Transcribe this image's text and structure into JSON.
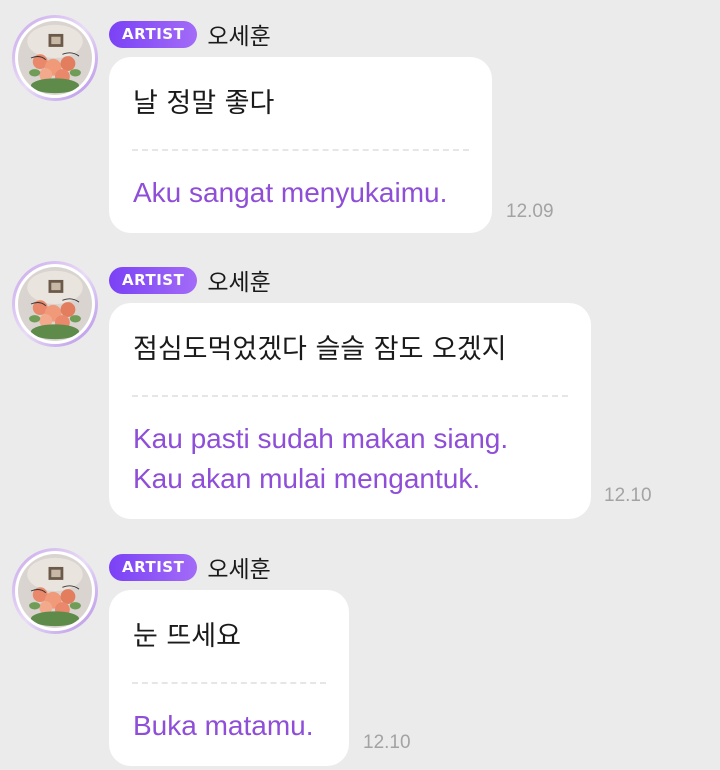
{
  "colors": {
    "background": "#ebebeb",
    "bubble": "#ffffff",
    "badge_start": "#7a42f5",
    "badge_end": "#a36bf7",
    "translation_text": "#8e4ed8",
    "timestamp": "#a3a3a3"
  },
  "messages": [
    {
      "avatar_icon": "profile-avatar-flowers",
      "badge": "ARTIST",
      "sender": "오세훈",
      "original": "날 정말 좋다",
      "translation_lines": [
        "Aku sangat menyukaimu."
      ],
      "time": "12.09"
    },
    {
      "avatar_icon": "profile-avatar-flowers",
      "badge": "ARTIST",
      "sender": "오세훈",
      "original": "점심도먹었겠다 슬슬 잠도 오겠지",
      "translation_lines": [
        "Kau pasti sudah makan siang.",
        "Kau akan mulai mengantuk."
      ],
      "time": "12.10"
    },
    {
      "avatar_icon": "profile-avatar-flowers",
      "badge": "ARTIST",
      "sender": "오세훈",
      "original": "눈 뜨세요",
      "translation_lines": [
        "Buka matamu."
      ],
      "time": "12.10"
    }
  ]
}
